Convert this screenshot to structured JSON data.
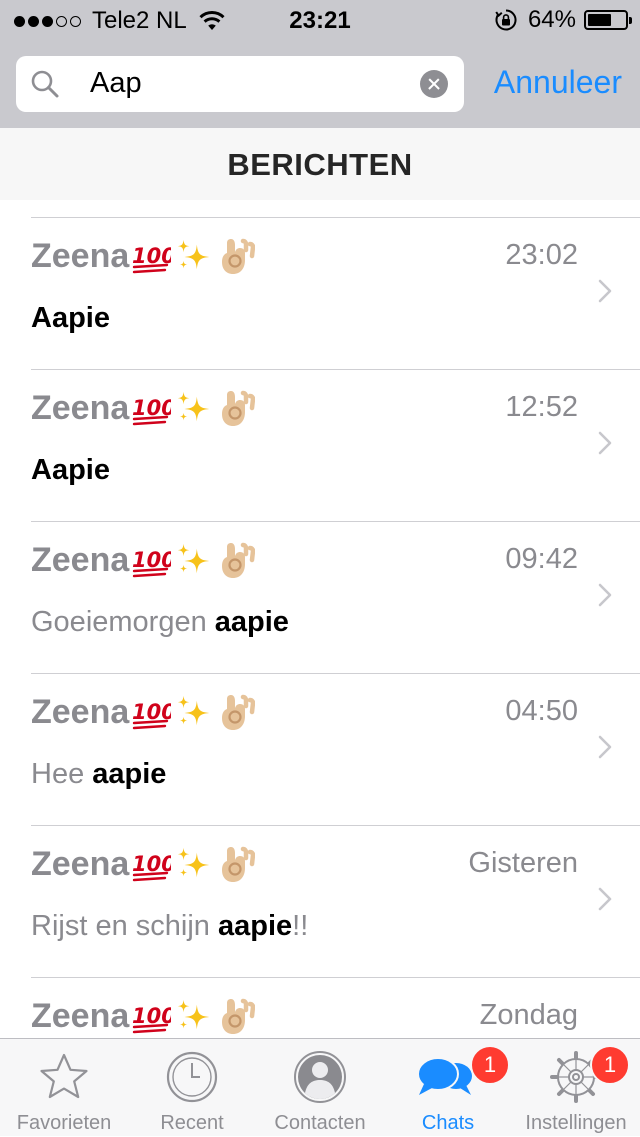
{
  "status_bar": {
    "signal_dots_filled": 3,
    "signal_dots_total": 5,
    "carrier": "Tele2 NL",
    "time": "23:21",
    "battery_percent_text": "64%",
    "battery_level": 0.64
  },
  "search": {
    "query": "Aap",
    "cancel_label": "Annuleer"
  },
  "section_title": "BERICHTEN",
  "results": [
    {
      "name": "Zeena",
      "time": "23:02",
      "preview_prefix": "",
      "preview_match": "Aapie",
      "preview_suffix": ""
    },
    {
      "name": "Zeena",
      "time": "12:52",
      "preview_prefix": "",
      "preview_match": "Aapie",
      "preview_suffix": ""
    },
    {
      "name": "Zeena",
      "time": "09:42",
      "preview_prefix": "Goeiemorgen ",
      "preview_match": "aapie",
      "preview_suffix": ""
    },
    {
      "name": "Zeena",
      "time": "04:50",
      "preview_prefix": "Hee ",
      "preview_match": "aapie",
      "preview_suffix": ""
    },
    {
      "name": "Zeena",
      "time": "Gisteren",
      "preview_prefix": "Rijst en schijn ",
      "preview_match": "aapie",
      "preview_suffix": "!!"
    },
    {
      "name": "Zeena",
      "time": "Zondag",
      "preview_prefix": "",
      "preview_match": "",
      "preview_suffix": ""
    }
  ],
  "name_emojis": [
    "hundred-points-icon",
    "sparkles-icon",
    "ok-hand-icon"
  ],
  "tabbar": {
    "tabs": [
      {
        "label": "Favorieten",
        "icon": "star-icon",
        "active": false,
        "badge": ""
      },
      {
        "label": "Recent",
        "icon": "clock-icon",
        "active": false,
        "badge": ""
      },
      {
        "label": "Contacten",
        "icon": "person-icon",
        "active": false,
        "badge": ""
      },
      {
        "label": "Chats",
        "icon": "chat-bubbles-icon",
        "active": true,
        "badge": "1"
      },
      {
        "label": "Instellingen",
        "icon": "gear-icon",
        "active": false,
        "badge": "1"
      }
    ]
  },
  "colors": {
    "accent": "#1a8cff",
    "badge": "#ff3b30",
    "header_bg": "#c9c9ce",
    "secondary_text": "#8a8a8f"
  }
}
